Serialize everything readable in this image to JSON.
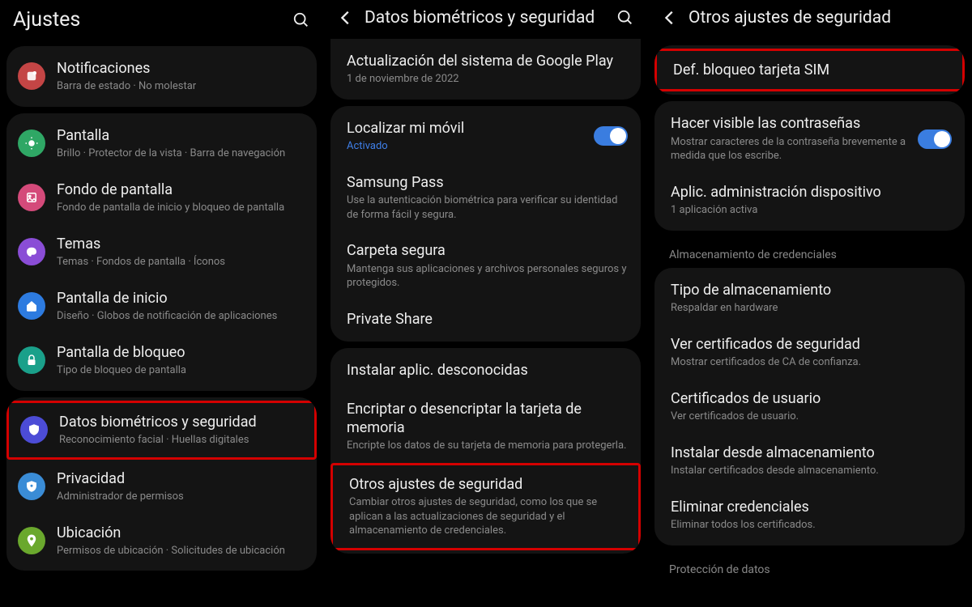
{
  "panel1": {
    "title": "Ajustes",
    "group1": {
      "notificaciones": {
        "title": "Notificaciones",
        "sub": "Barra de estado · No molestar"
      }
    },
    "group2": {
      "pantalla": {
        "title": "Pantalla",
        "sub": "Brillo · Protector de la vista · Barra de navegación"
      },
      "fondo": {
        "title": "Fondo de pantalla",
        "sub": "Fondo de pantalla de inicio y bloqueo de pantalla"
      },
      "temas": {
        "title": "Temas",
        "sub": "Temas · Fondos de pantalla · Íconos"
      },
      "inicio": {
        "title": "Pantalla de inicio",
        "sub": "Diseño · Globos de notificación de aplicaciones"
      },
      "bloqueo": {
        "title": "Pantalla de bloqueo",
        "sub": "Tipo de bloqueo de pantalla"
      }
    },
    "group3": {
      "biometria": {
        "title": "Datos biométricos y seguridad",
        "sub": "Reconocimiento facial · Huellas digitales"
      },
      "privacidad": {
        "title": "Privacidad",
        "sub": "Administrador de permisos"
      },
      "ubicacion": {
        "title": "Ubicación",
        "sub": "Permisos de ubicación · Solicitudes de ubicación"
      }
    }
  },
  "panel2": {
    "title": "Datos biométricos y seguridad",
    "group1": {
      "gplay": {
        "title": "Actualización del sistema de Google Play",
        "sub": "1 de noviembre de 2022"
      }
    },
    "group2": {
      "localizar": {
        "title": "Localizar mi móvil",
        "sub": "Activado"
      },
      "spass": {
        "title": "Samsung Pass",
        "sub": "Use la autenticación biométrica para verificar su identidad de forma fácil y segura."
      },
      "carpeta": {
        "title": "Carpeta segura",
        "sub": "Mantenga sus aplicaciones y archivos personales seguros y protegidos."
      },
      "private": {
        "title": "Private Share"
      }
    },
    "group3": {
      "desconocidas": {
        "title": "Instalar aplic. desconocidas"
      },
      "encriptar": {
        "title": "Encriptar o desencriptar la tarjeta de memoria",
        "sub": "Encripte los datos de su tarjeta de memoria para protegerla."
      },
      "otros": {
        "title": "Otros ajustes de seguridad",
        "sub": "Cambiar otros ajustes de seguridad, como los que se aplican a las actualizaciones de seguridad y el almacenamiento de credenciales."
      }
    }
  },
  "panel3": {
    "title": "Otros ajustes de seguridad",
    "group1": {
      "sim": {
        "title": "Def. bloqueo tarjeta SIM"
      }
    },
    "group2": {
      "visible": {
        "title": "Hacer visible las contraseñas",
        "sub": "Mostrar caracteres de la contraseña brevemente a medida que los escribe."
      },
      "admin": {
        "title": "Aplic. administración dispositivo",
        "sub": "1 aplicación activa"
      }
    },
    "section_cred": "Almacenamiento de credenciales",
    "group3": {
      "tipo": {
        "title": "Tipo de almacenamiento",
        "sub": "Respaldar en hardware"
      },
      "vercert": {
        "title": "Ver certificados de seguridad",
        "sub": "Mostrar certificados de CA de confianza."
      },
      "usuario": {
        "title": "Certificados de usuario",
        "sub": "Ver certificados de usuario."
      },
      "instalar": {
        "title": "Instalar desde almacenamiento",
        "sub": "Instalar certificados desde almacenamiento."
      },
      "eliminar": {
        "title": "Eliminar credenciales",
        "sub": "Eliminar todos los certificados."
      }
    },
    "section_prot": "Protección de datos"
  }
}
